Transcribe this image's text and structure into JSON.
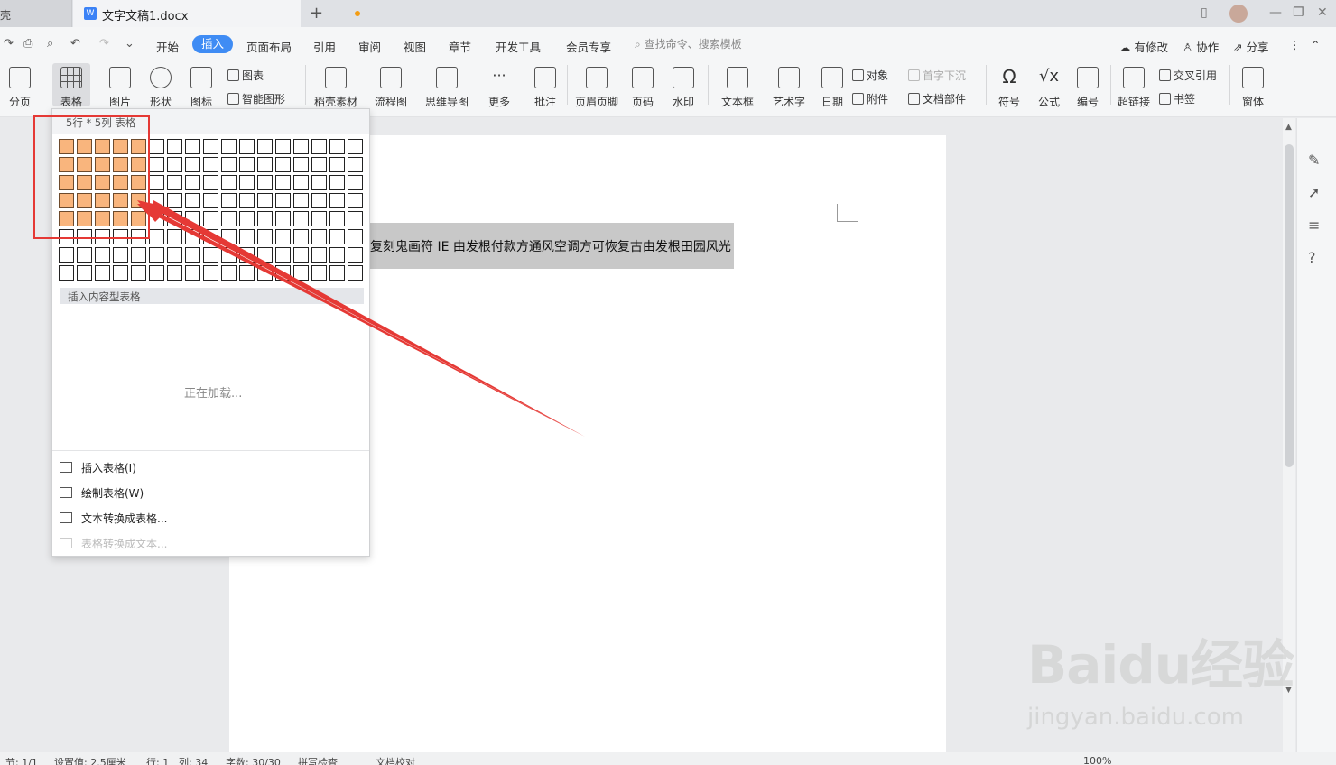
{
  "titlebar": {
    "prev_tab_label": "壳",
    "doc_tab_label": "文字文稿1.docx",
    "new_tab_symbol": "+",
    "window_controls": [
      "—",
      "❐",
      "✕"
    ]
  },
  "menubar": {
    "items": [
      "开始",
      "插入",
      "页面布局",
      "引用",
      "审阅",
      "视图",
      "章节",
      "开发工具",
      "会员专享"
    ],
    "active": "插入",
    "search_placeholder": "查找命令、搜索模板",
    "right_items": [
      "有修改",
      "协作",
      "分享"
    ]
  },
  "ribbon": {
    "buttons": [
      "分页",
      "表格",
      "图片",
      "形状",
      "图标",
      "稻壳素材",
      "流程图",
      "思维导图",
      "更多",
      "批注",
      "页眉页脚",
      "页码",
      "水印",
      "文本框",
      "艺术字",
      "日期",
      "符号",
      "公式",
      "编号",
      "超链接",
      "窗体"
    ],
    "small_buttons": [
      "图表",
      "智能图形",
      "对象",
      "附件",
      "首字下沉",
      "文档部件",
      "交叉引用",
      "书签"
    ]
  },
  "document": {
    "selected_text": "复刻鬼画符 IE 由发根付款方通风空调方可恢复古由发根田园风光"
  },
  "table_dropdown": {
    "header": "5行 * 5列 表格",
    "rows": 8,
    "cols": 17,
    "selected_rows": 5,
    "selected_cols": 5,
    "content_table_label": "插入内容型表格",
    "loading_text": "正在加载...",
    "menu": [
      {
        "label": "插入表格(I)",
        "enabled": true
      },
      {
        "label": "绘制表格(W)",
        "enabled": true
      },
      {
        "label": "文本转换成表格...",
        "enabled": true
      },
      {
        "label": "表格转换成文本...",
        "enabled": false
      }
    ]
  },
  "statusbar": {
    "items": [
      "节: 1/1",
      "设置值: 2.5厘米",
      "行: 1",
      "列: 34",
      "字数: 30/30",
      "拼写检查",
      "文档校对"
    ],
    "zoom": "100%"
  },
  "watermark": {
    "brand": "Baidu经验",
    "url": "jingyan.baidu.com"
  },
  "colors": {
    "accent": "#3f8cf4",
    "cell_selected": "#f9b57d",
    "annotation_red": "#e53935",
    "unsaved_dot": "#f39c12"
  }
}
